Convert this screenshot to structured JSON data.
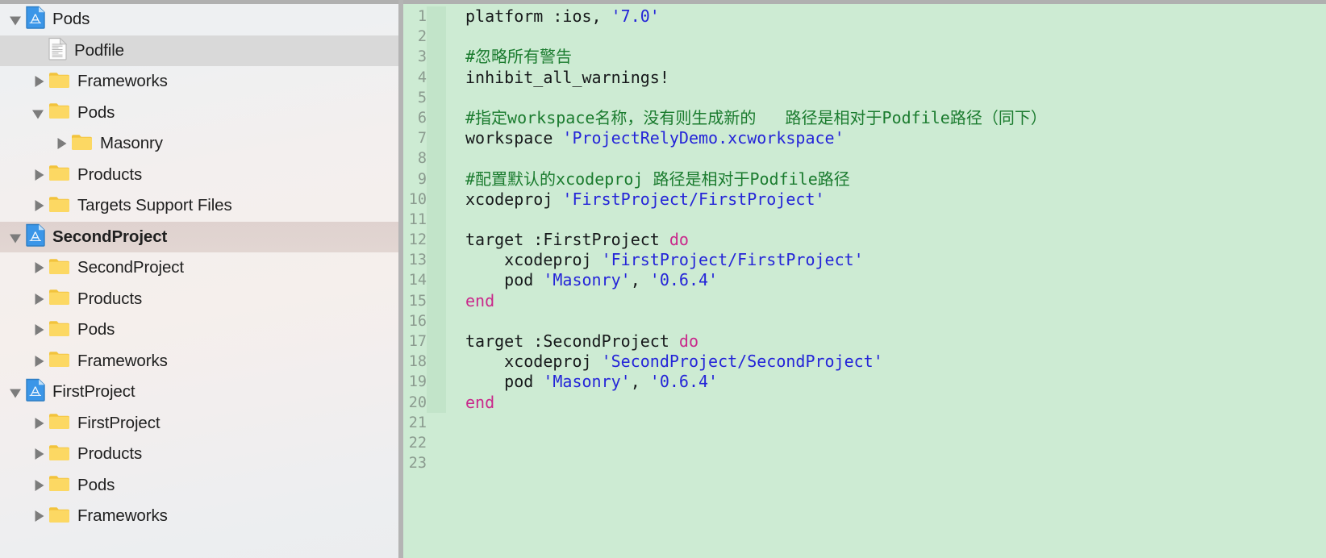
{
  "navigator": {
    "rows": [
      {
        "label": "Pods",
        "icon": "xcode-project-icon",
        "indent": 0,
        "twisty": "open",
        "selected": "none"
      },
      {
        "label": "Podfile",
        "icon": "document-icon",
        "indent": 1,
        "twisty": "none",
        "selected": "gray"
      },
      {
        "label": "Frameworks",
        "icon": "folder-icon",
        "indent": 1,
        "twisty": "closed",
        "selected": "none"
      },
      {
        "label": "Pods",
        "icon": "folder-icon",
        "indent": 1,
        "twisty": "open",
        "selected": "none"
      },
      {
        "label": "Masonry",
        "icon": "folder-icon",
        "indent": 2,
        "twisty": "closed",
        "selected": "none"
      },
      {
        "label": "Products",
        "icon": "folder-icon",
        "indent": 1,
        "twisty": "closed",
        "selected": "none"
      },
      {
        "label": "Targets Support Files",
        "icon": "folder-icon",
        "indent": 1,
        "twisty": "closed",
        "selected": "none"
      },
      {
        "label": "SecondProject",
        "icon": "xcode-project-icon",
        "indent": 0,
        "twisty": "open",
        "selected": "pink",
        "bold": true
      },
      {
        "label": "SecondProject",
        "icon": "folder-icon",
        "indent": 1,
        "twisty": "closed",
        "selected": "none"
      },
      {
        "label": "Products",
        "icon": "folder-icon",
        "indent": 1,
        "twisty": "closed",
        "selected": "none"
      },
      {
        "label": "Pods",
        "icon": "folder-icon",
        "indent": 1,
        "twisty": "closed",
        "selected": "none"
      },
      {
        "label": "Frameworks",
        "icon": "folder-icon",
        "indent": 1,
        "twisty": "closed",
        "selected": "none"
      },
      {
        "label": "FirstProject",
        "icon": "xcode-project-icon",
        "indent": 0,
        "twisty": "open",
        "selected": "none"
      },
      {
        "label": "FirstProject",
        "icon": "folder-icon",
        "indent": 1,
        "twisty": "closed",
        "selected": "none"
      },
      {
        "label": "Products",
        "icon": "folder-icon",
        "indent": 1,
        "twisty": "closed",
        "selected": "none"
      },
      {
        "label": "Pods",
        "icon": "folder-icon",
        "indent": 1,
        "twisty": "closed",
        "selected": "none"
      },
      {
        "label": "Frameworks",
        "icon": "folder-icon",
        "indent": 1,
        "twisty": "closed",
        "selected": "none"
      }
    ]
  },
  "editor": {
    "filename": "Podfile",
    "language": "ruby",
    "total_lines": 23,
    "line_numbers": [
      "1",
      "2",
      "3",
      "4",
      "5",
      "6",
      "7",
      "8",
      "9",
      "10",
      "11",
      "12",
      "13",
      "14",
      "15",
      "16",
      "17",
      "18",
      "19",
      "20",
      "21",
      "22",
      "23"
    ],
    "lines": [
      {
        "n": 1,
        "text": "platform :ios, '7.0'",
        "tokens": [
          {
            "t": "platform :ios, ",
            "c": "pln"
          },
          {
            "t": "'7.0'",
            "c": "str"
          }
        ]
      },
      {
        "n": 2,
        "text": "",
        "tokens": []
      },
      {
        "n": 3,
        "text": "#忽略所有警告",
        "tokens": [
          {
            "t": "#忽略所有警告",
            "c": "cmt"
          }
        ]
      },
      {
        "n": 4,
        "text": "inhibit_all_warnings!",
        "tokens": [
          {
            "t": "inhibit_all_warnings!",
            "c": "pln"
          }
        ]
      },
      {
        "n": 5,
        "text": "",
        "tokens": []
      },
      {
        "n": 6,
        "text": "#指定workspace名称，没有则生成新的   路径是相对于Podfile路径（同下）",
        "tokens": [
          {
            "t": "#指定workspace名称，没有则生成新的   路径是相对于Podfile路径（同下）",
            "c": "cmt"
          }
        ]
      },
      {
        "n": 7,
        "text": "workspace 'ProjectRelyDemo.xcworkspace'",
        "tokens": [
          {
            "t": "workspace ",
            "c": "pln"
          },
          {
            "t": "'ProjectRelyDemo.xcworkspace'",
            "c": "str"
          }
        ]
      },
      {
        "n": 8,
        "text": "",
        "tokens": []
      },
      {
        "n": 9,
        "text": "#配置默认的xcodeproj 路径是相对于Podfile路径",
        "tokens": [
          {
            "t": "#配置默认的xcodeproj 路径是相对于Podfile路径",
            "c": "cmt"
          }
        ]
      },
      {
        "n": 10,
        "text": "xcodeproj 'FirstProject/FirstProject'",
        "tokens": [
          {
            "t": "xcodeproj ",
            "c": "pln"
          },
          {
            "t": "'FirstProject/FirstProject'",
            "c": "str"
          }
        ]
      },
      {
        "n": 11,
        "text": "",
        "tokens": []
      },
      {
        "n": 12,
        "text": "target :FirstProject do",
        "tokens": [
          {
            "t": "target :FirstProject ",
            "c": "pln"
          },
          {
            "t": "do",
            "c": "kw"
          }
        ]
      },
      {
        "n": 13,
        "text": "    xcodeproj 'FirstProject/FirstProject'",
        "tokens": [
          {
            "t": "    xcodeproj ",
            "c": "pln"
          },
          {
            "t": "'FirstProject/FirstProject'",
            "c": "str"
          }
        ]
      },
      {
        "n": 14,
        "text": "    pod 'Masonry', '0.6.4'",
        "tokens": [
          {
            "t": "    pod ",
            "c": "pln"
          },
          {
            "t": "'Masonry'",
            "c": "str"
          },
          {
            "t": ", ",
            "c": "pln"
          },
          {
            "t": "'0.6.4'",
            "c": "str"
          }
        ]
      },
      {
        "n": 15,
        "text": "end",
        "tokens": [
          {
            "t": "end",
            "c": "kw"
          }
        ]
      },
      {
        "n": 16,
        "text": "",
        "tokens": []
      },
      {
        "n": 17,
        "text": "target :SecondProject do",
        "tokens": [
          {
            "t": "target :SecondProject ",
            "c": "pln"
          },
          {
            "t": "do",
            "c": "kw"
          }
        ]
      },
      {
        "n": 18,
        "text": "    xcodeproj 'SecondProject/SecondProject'",
        "tokens": [
          {
            "t": "    xcodeproj ",
            "c": "pln"
          },
          {
            "t": "'SecondProject/SecondProject'",
            "c": "str"
          }
        ]
      },
      {
        "n": 19,
        "text": "    pod 'Masonry', '0.6.4'",
        "tokens": [
          {
            "t": "    pod ",
            "c": "pln"
          },
          {
            "t": "'Masonry'",
            "c": "str"
          },
          {
            "t": ", ",
            "c": "pln"
          },
          {
            "t": "'0.6.4'",
            "c": "str"
          }
        ]
      },
      {
        "n": 20,
        "text": "end",
        "tokens": [
          {
            "t": "end",
            "c": "kw"
          }
        ]
      },
      {
        "n": 21,
        "text": "",
        "tokens": []
      },
      {
        "n": 22,
        "text": "",
        "tokens": []
      },
      {
        "n": 23,
        "text": "",
        "tokens": []
      }
    ]
  },
  "colors": {
    "editor_background": "#cdebd3",
    "gutter_text": "#8b9b8f",
    "change_bar": "#c2e4c9",
    "string": "#2424d8",
    "keyword": "#c9288b",
    "comment": "#1a7b2e",
    "plain": "#16181a",
    "selection_gray": "#d9d9d9",
    "selection_pink": "#e0d3cf",
    "folder_yellow": "#f8cf52",
    "project_blue": "#3b96e8",
    "divider": "#b4b4b4"
  }
}
